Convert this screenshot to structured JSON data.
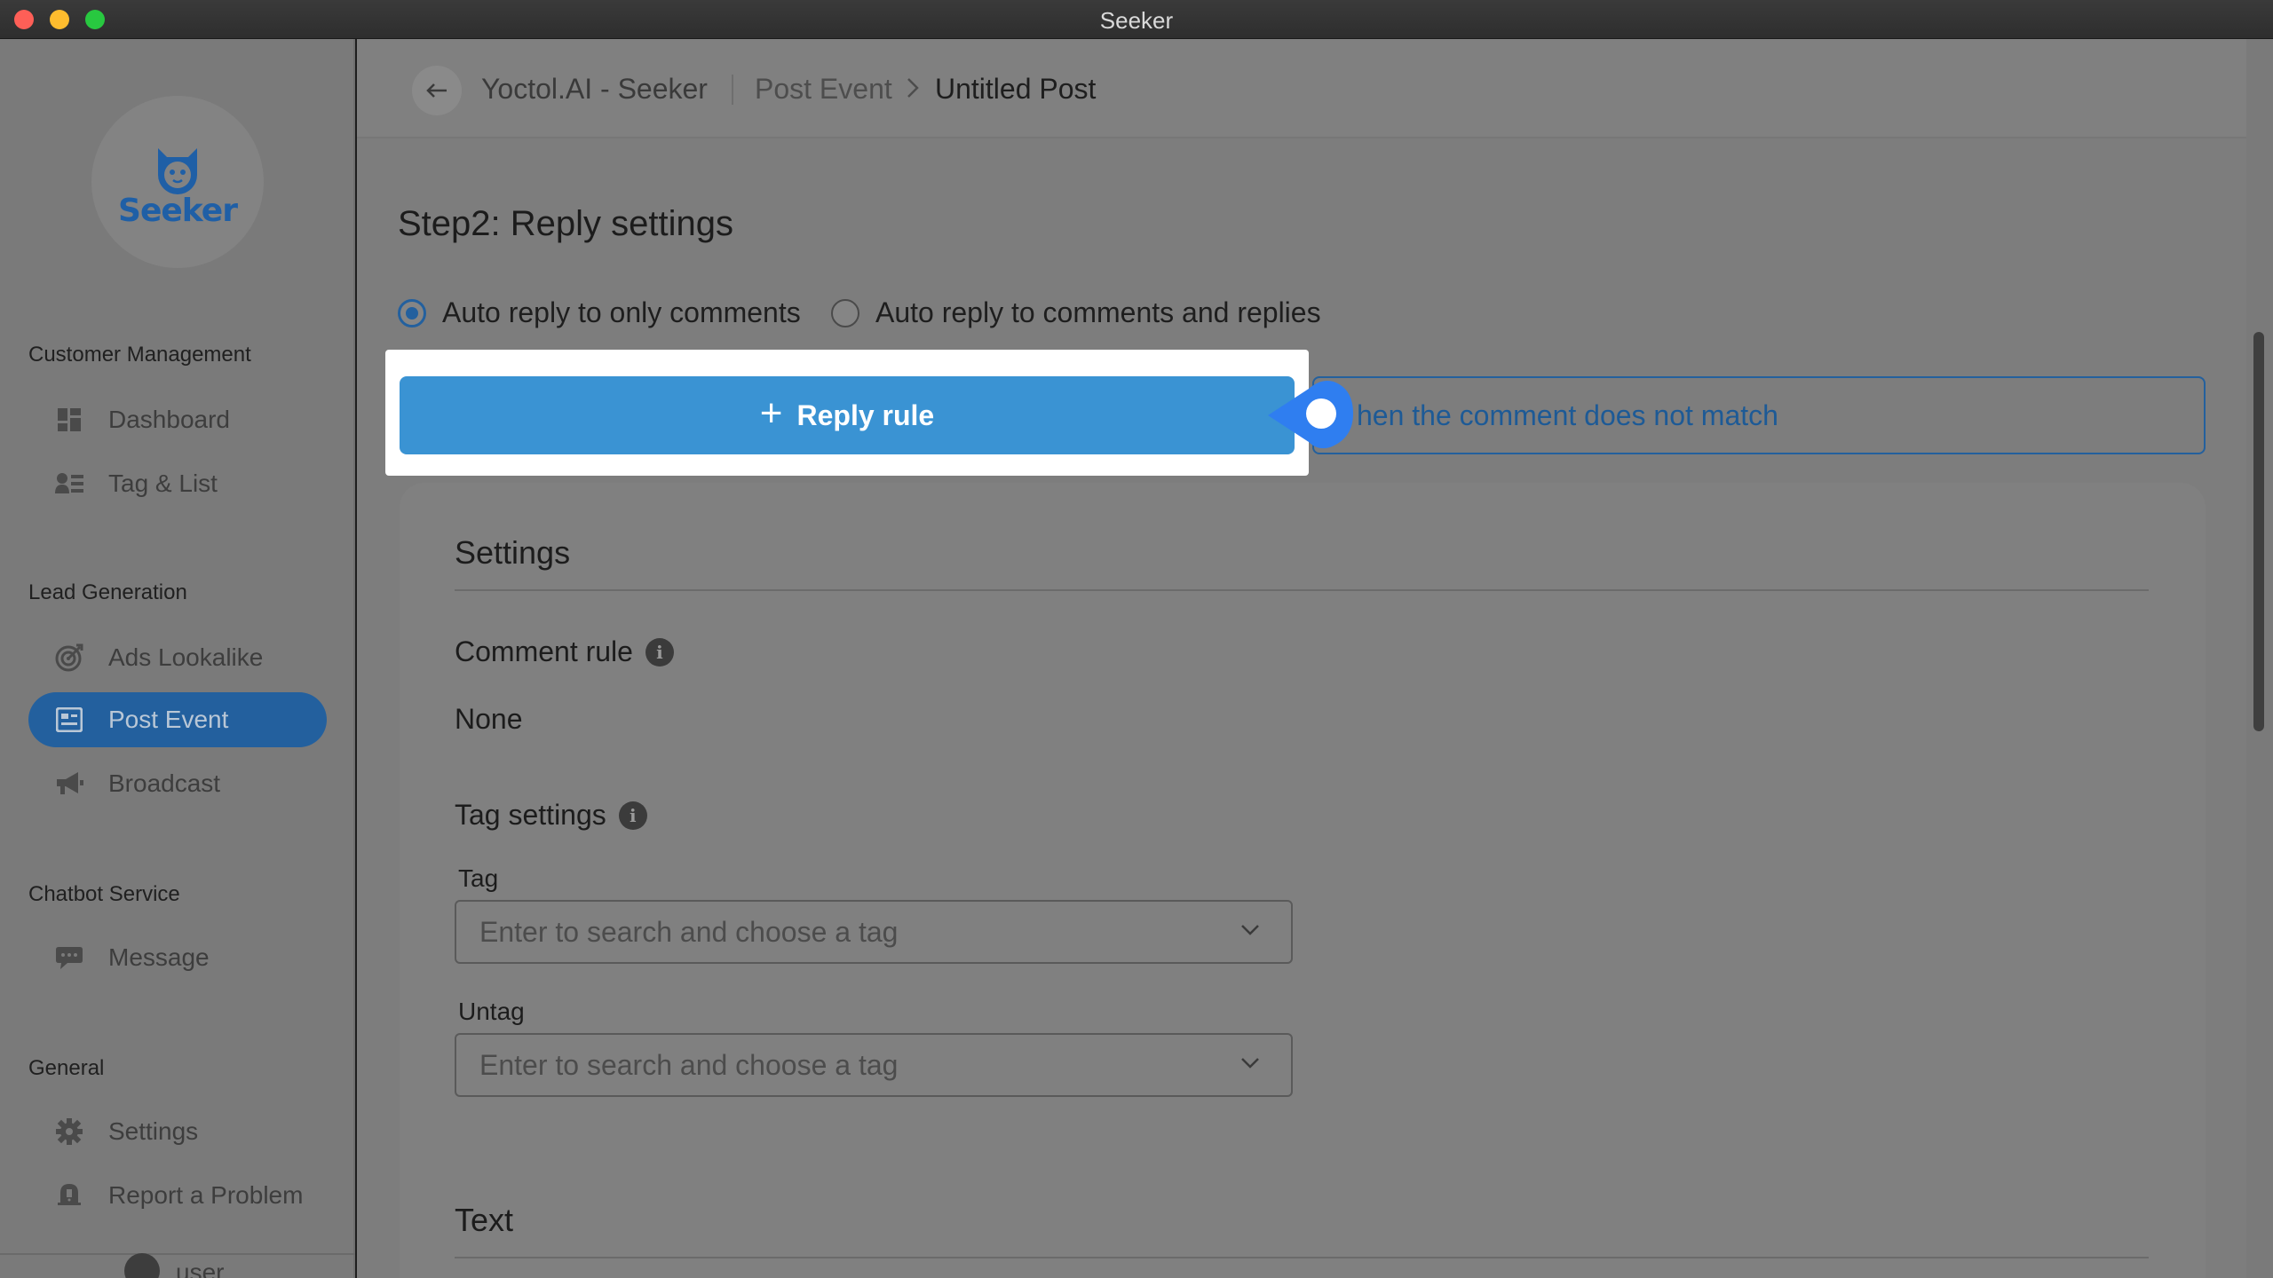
{
  "window": {
    "title": "Seeker"
  },
  "brand": {
    "logo_text": "Seeker",
    "color": "#1f5fa6"
  },
  "sidebar": {
    "sections": [
      {
        "title": "Customer Management",
        "items": [
          {
            "label": "Dashboard",
            "icon": "dashboard-icon"
          },
          {
            "label": "Tag & List",
            "icon": "tag-list-icon"
          }
        ]
      },
      {
        "title": "Lead Generation",
        "items": [
          {
            "label": "Ads Lookalike",
            "icon": "target-icon"
          },
          {
            "label": "Post Event",
            "icon": "post-event-icon",
            "active": true
          },
          {
            "label": "Broadcast",
            "icon": "megaphone-icon"
          }
        ]
      },
      {
        "title": "Chatbot Service",
        "items": [
          {
            "label": "Message",
            "icon": "chat-bubble-icon"
          }
        ]
      },
      {
        "title": "General",
        "items": [
          {
            "label": "Settings",
            "icon": "gear-icon"
          },
          {
            "label": "Report a Problem",
            "icon": "bell-icon"
          }
        ]
      }
    ],
    "user": {
      "name": "user"
    }
  },
  "breadcrumb": {
    "app": "Yoctol.AI - Seeker",
    "section": "Post Event",
    "current": "Untitled Post"
  },
  "step": {
    "title": "Step2: Reply settings"
  },
  "reply_mode": {
    "options": [
      {
        "label": "Auto reply to only comments",
        "selected": true
      },
      {
        "label": "Auto reply to comments and replies",
        "selected": false
      }
    ]
  },
  "actions": {
    "reply_rule": "Reply rule",
    "no_match": "When the comment does not match",
    "no_match_visible": "hen the comment does not match"
  },
  "settings": {
    "title": "Settings",
    "comment_rule": {
      "title": "Comment rule",
      "value": "None"
    },
    "tag_settings": {
      "title": "Tag settings",
      "tag": {
        "label": "Tag",
        "placeholder": "Enter to search and choose a tag"
      },
      "untag": {
        "label": "Untag",
        "placeholder": "Enter to search and choose a tag"
      }
    },
    "text": {
      "title": "Text"
    }
  },
  "colors": {
    "accent": "#3a93d3",
    "primary": "#23609e",
    "pointer": "#2f7ef0"
  }
}
